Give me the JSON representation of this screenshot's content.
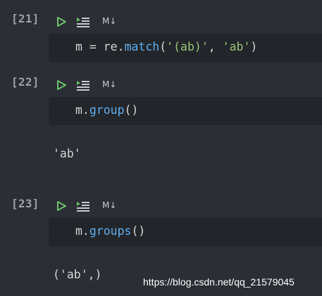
{
  "cells": [
    {
      "prompt": "[21]",
      "md_label": "M↓",
      "code": {
        "var": "m",
        "op": " = ",
        "obj": "re.",
        "fn": "match",
        "open": "(",
        "str1": "'(ab)'",
        "sep": ", ",
        "str2": "'ab'",
        "close": ")"
      }
    },
    {
      "prompt": "[22]",
      "md_label": "M↓",
      "code": {
        "obj": "m.",
        "fn": "group",
        "args": "()"
      },
      "output": "'ab'"
    },
    {
      "prompt": "[23]",
      "md_label": "M↓",
      "code": {
        "obj": "m.",
        "fn": "groups",
        "args": "()"
      },
      "output": "('ab',)"
    }
  ],
  "watermark": "https://blog.csdn.net/qq_21579045",
  "icons": {
    "run": "play-triangle-icon",
    "run_above": "run-all-above-icon"
  },
  "colors": {
    "background": "#2b2e34",
    "code_background": "#22252a",
    "run_icon": "#6cc06c",
    "function": "#61afef",
    "string": "#98c379",
    "text": "#d4d4d4",
    "prompt": "#9ba2ab"
  }
}
